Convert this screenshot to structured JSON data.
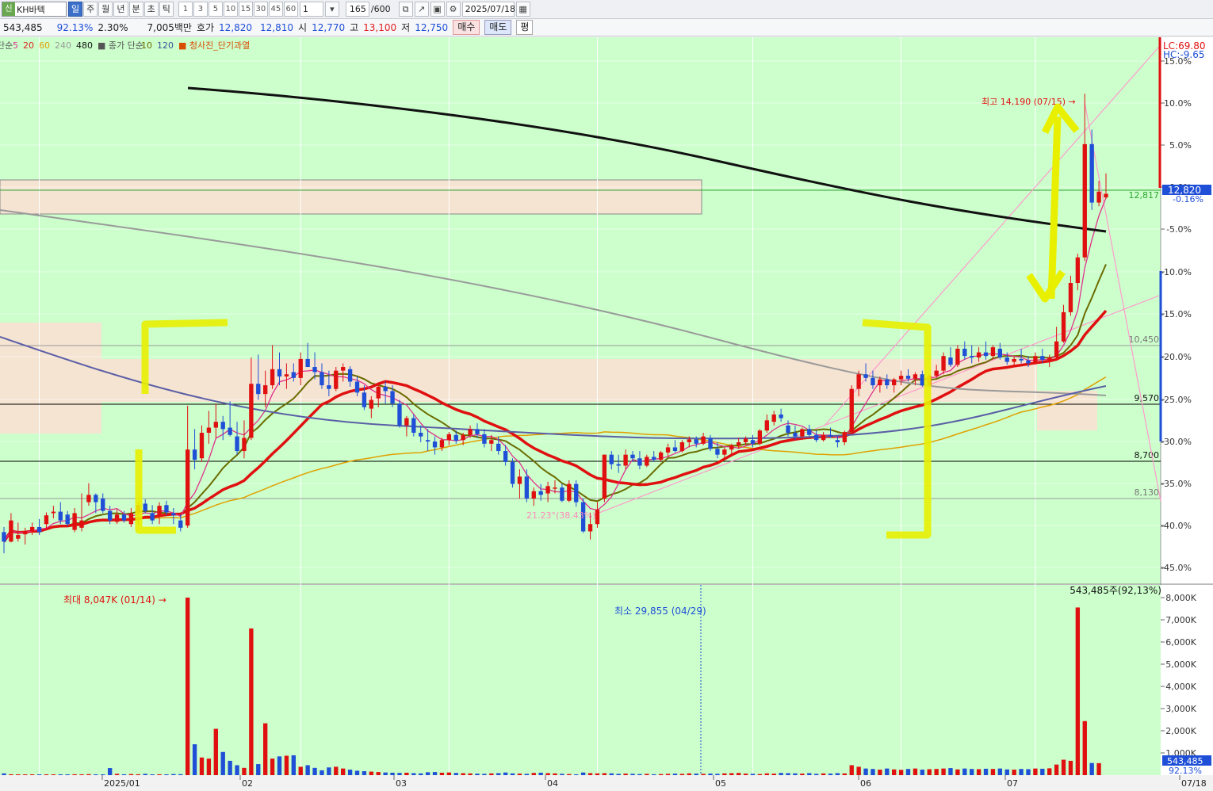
{
  "toolbar": {
    "stock_tag": "신",
    "stock_name": "KH바텍",
    "periods": [
      "일",
      "주",
      "월",
      "년",
      "분",
      "초",
      "틱"
    ],
    "active_period": "일",
    "intervals": [
      "1",
      "3",
      "5",
      "10",
      "15",
      "30",
      "45",
      "60"
    ],
    "interval_select": "1",
    "count": "165",
    "count_total": "/600",
    "date": "2025/07/18",
    "icons": [
      "candle-type-icon",
      "line-tool-icon",
      "save-icon",
      "settings-icon",
      "calendar-icon"
    ]
  },
  "quote": {
    "volume": "543,485",
    "volume_pct": "92.13%",
    "change_pct": "2.30%",
    "amount": "7,005백만",
    "ask_label": "호가",
    "ask": "12,820",
    "bid": "12,810",
    "open_label": "시",
    "open": "12,770",
    "high_label": "고",
    "high": "13,100",
    "low_label": "저",
    "low": "12,750",
    "buy_label": "매수",
    "sell_label": "매도",
    "eq_label": "평"
  },
  "legend": {
    "ma_prefix": "단순",
    "ma": [
      {
        "label": "5",
        "color": "#e0308c"
      },
      {
        "label": "20",
        "color": "#e02020"
      },
      {
        "label": "60",
        "color": "#e0a000"
      },
      {
        "label": "240",
        "color": "#9a9a9a"
      },
      {
        "label": "480",
        "color": "#111111"
      }
    ],
    "vol_label": "종가 단순",
    "vol_ma": [
      {
        "label": "10",
        "color": "#6b6b00"
      },
      {
        "label": "120",
        "color": "#3b4f9a"
      }
    ],
    "signal_label": "청사진_단기과열"
  },
  "chart_data": {
    "type": "candlestick",
    "title": "",
    "x_months": [
      "2025/01",
      "02",
      "03",
      "04",
      "05",
      "06",
      "07",
      "07/18"
    ],
    "y_axis_right_pct": [
      "15.0%",
      "10.0%",
      "5.0%",
      "0.0%",
      "-5.0%",
      "-10.0%",
      "-15.0%",
      "-20.0%",
      "-25.0%",
      "-30.0%",
      "-35.0%",
      "-40.0%",
      "-45.0%"
    ],
    "y_range": [
      7500,
      14800
    ],
    "current_price": "12,820",
    "current_pct": "-0.16%",
    "lc_label": "LC:69.80",
    "hc_label": "HC:-9.65",
    "hline_label_12817": "12,817",
    "price_lines": [
      {
        "value": 10450,
        "label": "10,450"
      },
      {
        "value": 9570,
        "label": "9,570"
      },
      {
        "value": 8700,
        "label": "8,700"
      },
      {
        "value": 8130,
        "label": "8,130"
      }
    ],
    "max_label": "최고 14,190 (07/15) →",
    "min_label": "21.23°(38.43%)",
    "candles_ohlc": [
      [
        8190,
        8260,
        7900,
        8060
      ],
      [
        8060,
        8450,
        8050,
        8350
      ],
      [
        8100,
        8320,
        8060,
        8150
      ],
      [
        8160,
        8250,
        8020,
        8200
      ],
      [
        8200,
        8320,
        8150,
        8260
      ],
      [
        8260,
        8370,
        8150,
        8190
      ],
      [
        8300,
        8460,
        8220,
        8420
      ],
      [
        8450,
        8550,
        8380,
        8470
      ],
      [
        8470,
        8600,
        8300,
        8350
      ],
      [
        8430,
        8480,
        8270,
        8300
      ],
      [
        8220,
        8520,
        8190,
        8450
      ],
      [
        8250,
        8720,
        8200,
        8350
      ],
      [
        8600,
        8860,
        8550,
        8700
      ],
      [
        8700,
        8720,
        8450,
        8600
      ],
      [
        8650,
        8720,
        8450,
        8480
      ],
      [
        8480,
        8550,
        8300,
        8350
      ],
      [
        8330,
        8500,
        8300,
        8430
      ],
      [
        8430,
        8480,
        8320,
        8350
      ],
      [
        8300,
        8520,
        8260,
        8450
      ],
      [
        8450,
        8600,
        8300,
        8560
      ],
      [
        8580,
        8640,
        8450,
        8480
      ],
      [
        8450,
        8560,
        8300,
        8350
      ],
      [
        8400,
        8600,
        8300,
        8550
      ],
      [
        8560,
        8620,
        8420,
        8460
      ],
      [
        8450,
        8520,
        8300,
        8420
      ],
      [
        8350,
        8430,
        8200,
        8250
      ],
      [
        8280,
        9920,
        8250,
        9320
      ],
      [
        9320,
        9600,
        9050,
        9180
      ],
      [
        9200,
        9650,
        9150,
        9550
      ],
      [
        9550,
        9850,
        9400,
        9620
      ],
      [
        9620,
        9950,
        9480,
        9700
      ],
      [
        9700,
        9780,
        9450,
        9600
      ],
      [
        9620,
        9980,
        9500,
        9520
      ],
      [
        9500,
        9700,
        9250,
        9300
      ],
      [
        9300,
        9720,
        9200,
        9480
      ],
      [
        9480,
        10580,
        9450,
        10220
      ],
      [
        10220,
        10620,
        10000,
        10080
      ],
      [
        10080,
        10400,
        9900,
        10200
      ],
      [
        10200,
        10750,
        10150,
        10420
      ],
      [
        10420,
        10650,
        10200,
        10320
      ],
      [
        10320,
        10500,
        10150,
        10350
      ],
      [
        10380,
        10500,
        10250,
        10300
      ],
      [
        10300,
        10650,
        10200,
        10560
      ],
      [
        10560,
        10780,
        10450,
        10450
      ],
      [
        10450,
        10650,
        10280,
        10380
      ],
      [
        10380,
        10500,
        10150,
        10200
      ],
      [
        10200,
        10400,
        10050,
        10150
      ],
      [
        10150,
        10450,
        10120,
        10400
      ],
      [
        10400,
        10500,
        10250,
        10450
      ],
      [
        10420,
        10460,
        10180,
        10250
      ],
      [
        10250,
        10320,
        10050,
        10100
      ],
      [
        10100,
        10200,
        9860,
        9900
      ],
      [
        9880,
        10050,
        9750,
        10000
      ],
      [
        10020,
        10220,
        9900,
        10180
      ],
      [
        10180,
        10250,
        9950,
        10120
      ],
      [
        10120,
        10200,
        9900,
        9950
      ],
      [
        9950,
        10000,
        9620,
        9650
      ],
      [
        9650,
        9780,
        9500,
        9750
      ],
      [
        9750,
        9800,
        9500,
        9550
      ],
      [
        9550,
        9650,
        9420,
        9500
      ],
      [
        9450,
        9600,
        9300,
        9430
      ],
      [
        9430,
        9500,
        9250,
        9350
      ],
      [
        9350,
        9480,
        9300,
        9450
      ],
      [
        9450,
        9560,
        9380,
        9530
      ],
      [
        9520,
        9580,
        9400,
        9440
      ],
      [
        9450,
        9550,
        9380,
        9520
      ],
      [
        9520,
        9650,
        9480,
        9600
      ],
      [
        9600,
        9680,
        9480,
        9530
      ],
      [
        9530,
        9600,
        9350,
        9400
      ],
      [
        9400,
        9520,
        9300,
        9450
      ],
      [
        9400,
        9500,
        9250,
        9300
      ],
      [
        9300,
        9380,
        9100,
        9150
      ],
      [
        9150,
        9200,
        8800,
        8850
      ],
      [
        8850,
        9050,
        8650,
        8950
      ],
      [
        8950,
        9050,
        8600,
        8650
      ],
      [
        8650,
        8800,
        8550,
        8750
      ],
      [
        8750,
        8850,
        8620,
        8700
      ],
      [
        8720,
        8880,
        8600,
        8820
      ],
      [
        8800,
        8900,
        8720,
        8800
      ],
      [
        8800,
        8850,
        8600,
        8620
      ],
      [
        8620,
        8900,
        8600,
        8850
      ],
      [
        8850,
        8900,
        8540,
        8600
      ],
      [
        8600,
        8650,
        8180,
        8200
      ],
      [
        8200,
        8450,
        8090,
        8300
      ],
      [
        8300,
        8600,
        8250,
        8500
      ],
      [
        8650,
        9250,
        8600,
        9250
      ],
      [
        9250,
        9300,
        9050,
        9120
      ],
      [
        9120,
        9250,
        9000,
        9100
      ],
      [
        9100,
        9320,
        9050,
        9250
      ],
      [
        9250,
        9300,
        9150,
        9200
      ],
      [
        9200,
        9300,
        9050,
        9100
      ],
      [
        9100,
        9250,
        9080,
        9220
      ],
      [
        9220,
        9300,
        9150,
        9180
      ],
      [
        9180,
        9300,
        9150,
        9280
      ],
      [
        9280,
        9400,
        9220,
        9350
      ],
      [
        9350,
        9450,
        9280,
        9300
      ],
      [
        9300,
        9450,
        9280,
        9420
      ],
      [
        9420,
        9500,
        9350,
        9460
      ],
      [
        9460,
        9500,
        9350,
        9400
      ],
      [
        9400,
        9550,
        9380,
        9500
      ],
      [
        9480,
        9520,
        9300,
        9330
      ],
      [
        9330,
        9420,
        9200,
        9250
      ],
      [
        9250,
        9350,
        9180,
        9320
      ],
      [
        9320,
        9400,
        9250,
        9380
      ],
      [
        9380,
        9480,
        9330,
        9420
      ],
      [
        9420,
        9500,
        9380,
        9470
      ],
      [
        9450,
        9520,
        9350,
        9400
      ],
      [
        9400,
        9600,
        9380,
        9580
      ],
      [
        9580,
        9800,
        9550,
        9720
      ],
      [
        9700,
        9850,
        9650,
        9800
      ],
      [
        9800,
        9880,
        9700,
        9750
      ],
      [
        9650,
        9720,
        9500,
        9550
      ],
      [
        9550,
        9650,
        9450,
        9500
      ],
      [
        9500,
        9620,
        9450,
        9600
      ],
      [
        9600,
        9660,
        9500,
        9520
      ],
      [
        9520,
        9580,
        9420,
        9450
      ],
      [
        9450,
        9560,
        9430,
        9520
      ],
      [
        9520,
        9620,
        9480,
        9500
      ],
      [
        9450,
        9500,
        9350,
        9420
      ],
      [
        9420,
        9580,
        9380,
        9560
      ],
      [
        9560,
        10200,
        9550,
        10150
      ],
      [
        10150,
        10400,
        10050,
        10350
      ],
      [
        10350,
        10500,
        10250,
        10300
      ],
      [
        10300,
        10400,
        10150,
        10200
      ],
      [
        10200,
        10320,
        10100,
        10280
      ],
      [
        10280,
        10350,
        10150,
        10200
      ],
      [
        10200,
        10300,
        10100,
        10280
      ],
      [
        10280,
        10400,
        10200,
        10330
      ],
      [
        10330,
        10420,
        10250,
        10290
      ],
      [
        10290,
        10380,
        10200,
        10350
      ],
      [
        10350,
        10400,
        10180,
        10200
      ],
      [
        10200,
        10350,
        10180,
        10330
      ],
      [
        10330,
        10480,
        10300,
        10400
      ],
      [
        10400,
        10650,
        10350,
        10600
      ],
      [
        10580,
        10720,
        10450,
        10480
      ],
      [
        10480,
        10750,
        10450,
        10700
      ],
      [
        10700,
        10800,
        10550,
        10600
      ],
      [
        10600,
        10750,
        10500,
        10580
      ],
      [
        10580,
        10720,
        10520,
        10650
      ],
      [
        10650,
        10800,
        10550,
        10600
      ],
      [
        10600,
        10750,
        10550,
        10720
      ],
      [
        10700,
        10780,
        10550,
        10580
      ],
      [
        10580,
        10650,
        10480,
        10520
      ],
      [
        10520,
        10600,
        10450,
        10560
      ],
      [
        10560,
        10700,
        10500,
        10540
      ],
      [
        10540,
        10600,
        10450,
        10500
      ],
      [
        10500,
        10650,
        10480,
        10600
      ],
      [
        10600,
        10700,
        10500,
        10550
      ],
      [
        10550,
        10620,
        10450,
        10580
      ],
      [
        10580,
        11000,
        10550,
        10800
      ],
      [
        10800,
        11300,
        10780,
        11200
      ],
      [
        11200,
        11700,
        11150,
        11600
      ],
      [
        11600,
        12000,
        11500,
        11950
      ],
      [
        11950,
        14190,
        11900,
        13500
      ],
      [
        13500,
        13700,
        12600,
        12700
      ],
      [
        12700,
        13000,
        12650,
        12850
      ],
      [
        12770,
        13100,
        12750,
        12820
      ]
    ],
    "volume": {
      "max_label": "최대 8,047K (01/14) →",
      "min_label": "최소 29,855 (04/29)",
      "last_label": "543,485주(92,13%)",
      "axis": [
        "8,000K",
        "7,000K",
        "6,000K",
        "5,000K",
        "4,000K",
        "3,000K",
        "2,000K",
        "1,000K"
      ],
      "last_value": "543,485",
      "last_pct": "92.13%",
      "values_k": [
        80,
        40,
        25,
        30,
        35,
        20,
        30,
        25,
        30,
        30,
        40,
        35,
        45,
        30,
        35,
        320,
        60,
        40,
        50,
        40,
        60,
        30,
        40,
        35,
        50,
        45,
        8047,
        1400,
        800,
        750,
        2100,
        1050,
        650,
        450,
        330,
        6650,
        500,
        2350,
        750,
        850,
        880,
        900,
        380,
        450,
        330,
        220,
        350,
        380,
        300,
        250,
        200,
        180,
        160,
        140,
        120,
        110,
        100,
        110,
        90,
        80,
        130,
        140,
        110,
        120,
        100,
        90,
        80,
        70,
        60,
        80,
        90,
        120,
        80,
        70,
        60,
        100,
        110,
        90,
        80,
        60,
        50,
        30,
        120,
        90,
        80,
        90,
        80,
        60,
        70,
        60,
        50,
        60,
        40,
        50,
        60,
        70,
        60,
        80,
        70,
        60,
        70,
        60,
        80,
        90,
        100,
        70,
        60,
        50,
        80,
        70,
        100,
        90,
        80,
        70,
        90,
        60,
        80,
        70,
        90,
        80,
        450,
        380,
        300,
        280,
        250,
        300,
        260,
        240,
        280,
        300,
        250,
        270,
        280,
        300,
        320,
        260,
        300,
        280,
        270,
        290,
        280,
        300,
        260,
        250,
        280,
        270,
        300,
        290,
        310,
        480,
        700,
        650,
        7600,
        2450,
        550,
        543
      ]
    }
  }
}
